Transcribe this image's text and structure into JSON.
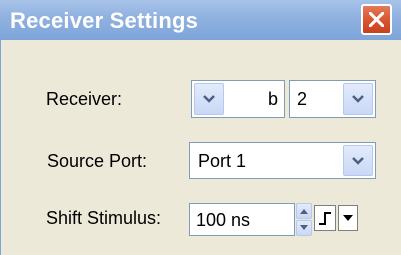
{
  "window": {
    "title": "Receiver Settings",
    "close_icon": "close-icon"
  },
  "receiver": {
    "label": "Receiver:",
    "first_value": "b",
    "second_value": "2",
    "dropdown_icon": "chevron-down-icon"
  },
  "source_port": {
    "label": "Source Port:",
    "value": "Port 1",
    "dropdown_icon": "chevron-down-icon"
  },
  "shift_stimulus": {
    "label": "Shift Stimulus:",
    "value": "100 ns",
    "spinner_icon": "spinner-icon",
    "step_icon": "step-icon",
    "menu_icon": "triangle-down-icon"
  },
  "colors": {
    "titlebar": "#8fb1e0",
    "close_button": "#d8532f",
    "panel_background": "#ece9d8",
    "dropdown_button": "#c9d8f5"
  }
}
